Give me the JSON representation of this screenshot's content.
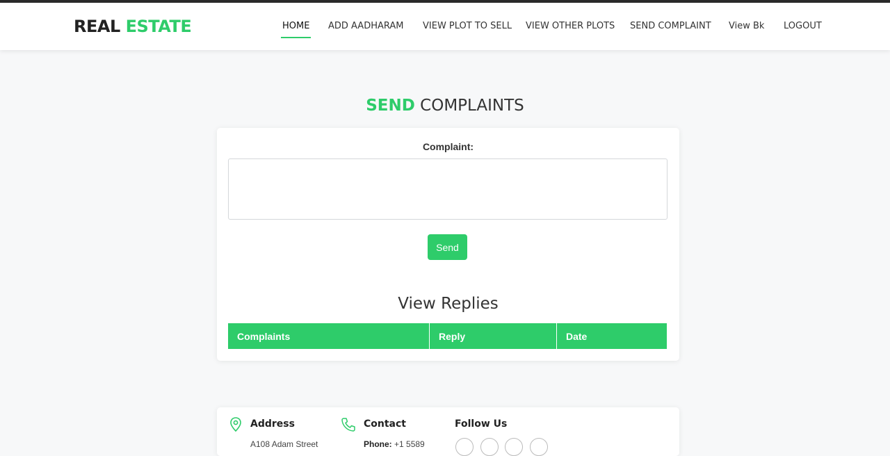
{
  "header": {
    "logo_part1": "REAL",
    "logo_part2": "ESTATE",
    "nav": [
      {
        "label": "HOME",
        "active": true
      },
      {
        "label": "ADD AADHARAM"
      },
      {
        "label": "VIEW PLOT TO SELL"
      },
      {
        "label": "VIEW OTHER PLOTS"
      },
      {
        "label": "SEND COMPLAINT"
      },
      {
        "label": "View Bk"
      },
      {
        "label": "LOGOUT"
      }
    ]
  },
  "page": {
    "title_accent": "SEND",
    "title_rest": "COMPLAINTS"
  },
  "form": {
    "complaint_label": "Complaint:",
    "complaint_value": "",
    "send_label": "Send"
  },
  "replies": {
    "title": "View Replies",
    "columns": [
      "Complaints",
      "Reply",
      "Date"
    ],
    "rows": []
  },
  "footer": {
    "address_title": "Address",
    "address_text": "A108 Adam Street",
    "contact_title": "Contact",
    "contact_phone_label": "Phone:",
    "contact_phone_value": "+1 5589",
    "follow_title": "Follow Us",
    "social_icons": [
      "social-icon-1",
      "social-icon-2",
      "social-icon-3",
      "social-icon-4"
    ]
  },
  "colors": {
    "accent": "#2ecc6a",
    "text": "#333333",
    "background": "#f7f8f9"
  }
}
